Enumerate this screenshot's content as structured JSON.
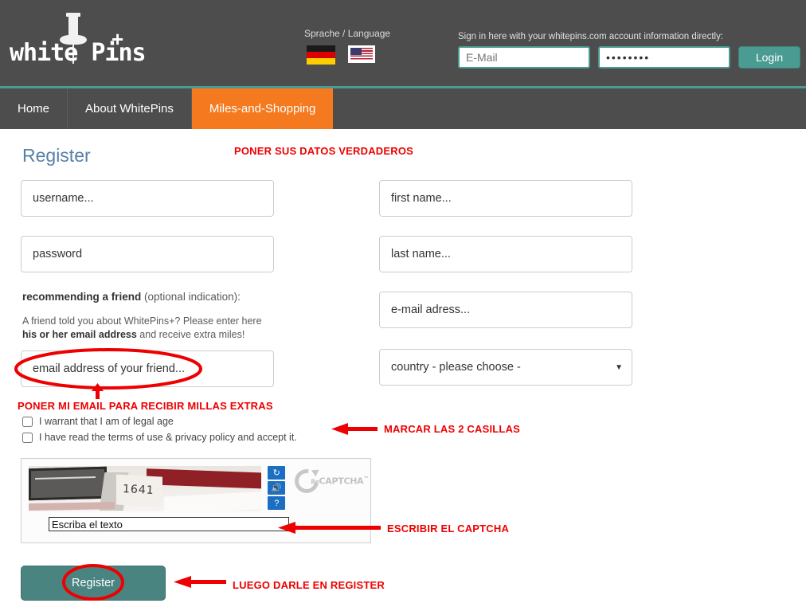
{
  "header": {
    "logo": {
      "text": "white Pins",
      "plus": "+",
      "icon": "pushpin-icon"
    },
    "language": {
      "label": "Sprache / Language",
      "options": [
        {
          "name": "german-flag",
          "code": "de",
          "selected": false
        },
        {
          "name": "us-flag",
          "code": "us",
          "selected": true
        }
      ]
    },
    "signin": {
      "label": "Sign in here with your whitepins.com account information directly:",
      "email_placeholder": "E-Mail",
      "email_value": "",
      "password_value": "••••••••",
      "login_label": "Login"
    }
  },
  "nav": {
    "items": [
      {
        "label": "Home",
        "active": false
      },
      {
        "label": "About WhitePins",
        "active": false
      },
      {
        "label": "Miles-and-Shopping",
        "active": true
      }
    ]
  },
  "form": {
    "title": "Register",
    "username_placeholder": "username...",
    "password_placeholder": "password",
    "firstname_placeholder": "first name...",
    "lastname_placeholder": "last name...",
    "email_placeholder": "e-mail adress...",
    "friend_title_bold": "recommending a friend",
    "friend_title_rest": " (optional indication):",
    "friend_desc_1": "A friend told you about WhitePins+? Please enter here ",
    "friend_desc_bold": "his or her email address",
    "friend_desc_2": " and receive extra miles!",
    "friend_placeholder": "email address of your friend...",
    "country_selected": "country - please choose -",
    "country_arrow": "▼",
    "checkbox_1": "I warrant that I am of legal age",
    "checkbox_2": "I have read the terms of use & privacy policy and accept it.",
    "register_label": "Register"
  },
  "captcha": {
    "image_text": "1641",
    "input_value": "Escriba el texto",
    "refresh_icon": "↻",
    "audio_icon": "🔊",
    "help_icon": "?",
    "brand_re": "Re",
    "brand_name": "CAPTCHA",
    "brand_tm": "™"
  },
  "annotations": [
    {
      "id": "anno-1",
      "text": "PONER SUS DATOS VERDADEROS"
    },
    {
      "id": "anno-2",
      "text": "PONER MI EMAIL PARA RECIBIR MILLAS EXTRAS"
    },
    {
      "id": "anno-3",
      "text": "MARCAR LAS 2 CASILLAS"
    },
    {
      "id": "anno-4",
      "text": "ESCRIBIR EL CAPTCHA"
    },
    {
      "id": "anno-5",
      "text": "LUEGO DARLE EN REGISTER"
    }
  ],
  "colors": {
    "header_bg": "#4d4d4d",
    "accent_teal": "#4a9b92",
    "nav_active": "#f4791f",
    "title_blue": "#5a7fa8",
    "annotation_red": "#ee0000",
    "register_btn": "#4a8480"
  }
}
